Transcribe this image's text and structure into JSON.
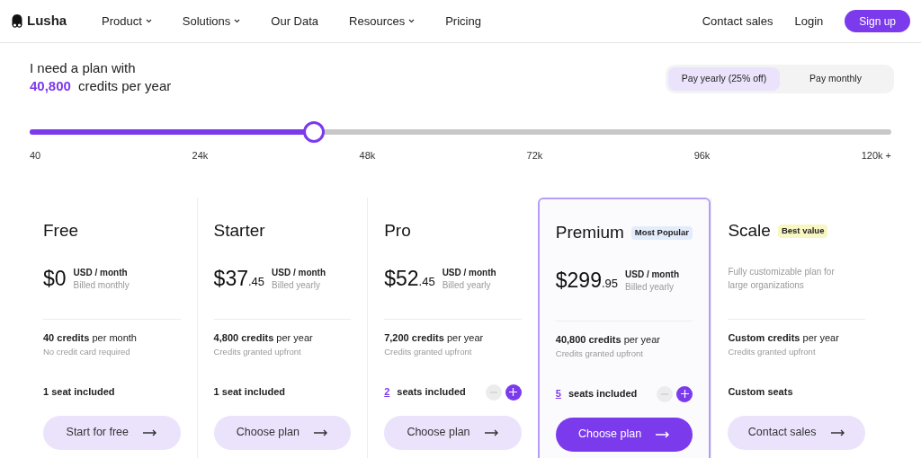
{
  "nav": {
    "logo": "Lusha",
    "items": [
      {
        "label": "Product",
        "dropdown": true
      },
      {
        "label": "Solutions",
        "dropdown": true
      },
      {
        "label": "Our Data",
        "dropdown": false
      },
      {
        "label": "Resources",
        "dropdown": true
      },
      {
        "label": "Pricing",
        "dropdown": false
      }
    ],
    "contact": "Contact sales",
    "login": "Login",
    "signup": "Sign up"
  },
  "plan_picker": {
    "heading": "I need a plan with",
    "amount": "40,800",
    "unit": "credits per year",
    "billing": [
      {
        "label": "Pay yearly (25% off)",
        "selected": true
      },
      {
        "label": "Pay monthly",
        "selected": false
      }
    ],
    "slider": {
      "level": 0.33,
      "ticks": [
        "40",
        "24k",
        "48k",
        "72k",
        "96k",
        "120k +"
      ]
    }
  },
  "plans": [
    {
      "name": "Free",
      "selected": false,
      "kind": "price",
      "price": "$0",
      "per": "USD / month",
      "billing": "Billed monthly",
      "credits": "40 credits",
      "credits_period": "per month",
      "note": "No credit card required",
      "seats": {
        "kind": "fixed",
        "text": "1 seat included"
      },
      "button": "Start for free"
    },
    {
      "name": "Starter",
      "selected": false,
      "kind": "price",
      "price": "$37",
      "cents": ".45",
      "per": "USD / month",
      "billing": "Billed yearly",
      "credits": "4,800 credits",
      "credits_period": "per year",
      "note": "Credits granted upfront",
      "seats": {
        "kind": "fixed",
        "text": "1 seat included"
      },
      "button": "Choose plan"
    },
    {
      "name": "Pro",
      "selected": false,
      "kind": "price",
      "price": "$52",
      "cents": ".45",
      "per": "USD / month",
      "billing": "Billed yearly",
      "credits": "7,200 credits",
      "credits_period": "per year",
      "note": "Credits granted upfront",
      "seats": {
        "kind": "adjustable",
        "count": "2",
        "text": "seats included"
      },
      "button": "Choose plan"
    },
    {
      "name": "Premium",
      "selected": true,
      "badge": {
        "text": "Most Popular",
        "color": "#e3ecfb"
      },
      "kind": "price",
      "price": "$299",
      "cents": ".95",
      "per": "USD / month",
      "billing": "Billed yearly",
      "credits": "40,800 credits",
      "credits_period": "per year",
      "note": "Credits granted upfront",
      "seats": {
        "kind": "adjustable",
        "count": "5",
        "text": "seats included"
      },
      "button": "Choose plan"
    },
    {
      "name": "Scale",
      "selected": false,
      "badge": {
        "text": "Best value",
        "color": "#f8f7c4"
      },
      "kind": "description",
      "description": "Fully customizable plan for large organizations",
      "credits": "Custom credits",
      "credits_period": "per year",
      "note": "Credits granted upfront",
      "seats": {
        "kind": "fixed",
        "text": "Custom seats"
      },
      "button": "Contact sales"
    }
  ]
}
